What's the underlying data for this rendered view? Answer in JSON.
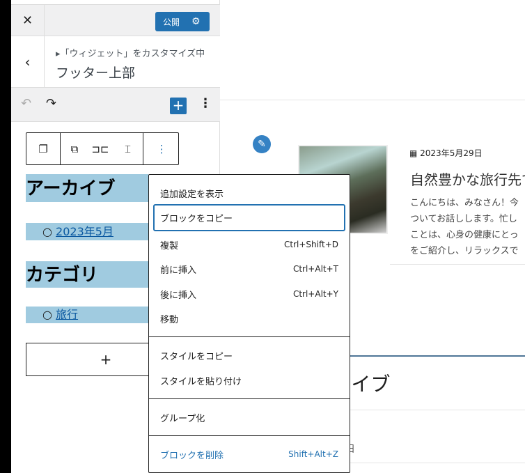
{
  "header": {
    "close_icon": "close-icon",
    "publish_label": "公開",
    "settings_icon": "gear-icon"
  },
  "nav": {
    "breadcrumb": "▸「ウィジェット」をカスタマイズ中",
    "title": "フッター上部"
  },
  "editor_toolbar": {
    "undo_icon": "undo-icon",
    "redo_icon": "redo-icon",
    "add_icon": "plus-icon",
    "options_icon": "more-vertical-icon"
  },
  "block_toolbar": {
    "icons": [
      "parent-select-icon",
      "duplicate-icon",
      "move-horizontal-icon",
      "move-vertical-icon",
      "more-vertical-icon"
    ]
  },
  "widgets": {
    "archive_heading": "アーカイブ",
    "archive_link": "2023年5月",
    "category_heading": "カテゴリ",
    "category_link": "旅行",
    "add_block": "+"
  },
  "menu": {
    "items": [
      {
        "label": "追加設定を表示",
        "shortcut": ""
      },
      {
        "label": "ブロックをコピー",
        "shortcut": ""
      },
      {
        "label": "複製",
        "shortcut": "Ctrl+Shift+D"
      },
      {
        "label": "前に挿入",
        "shortcut": "Ctrl+Alt+T"
      },
      {
        "label": "後に挿入",
        "shortcut": "Ctrl+Alt+Y"
      },
      {
        "label": "移動",
        "shortcut": ""
      },
      {
        "label": "スタイルをコピー",
        "shortcut": ""
      },
      {
        "label": "スタイルを貼り付け",
        "shortcut": ""
      },
      {
        "label": "グループ化",
        "shortcut": ""
      },
      {
        "label": "ブロックを削除",
        "shortcut": "Shift+Alt+Z"
      }
    ]
  },
  "preview": {
    "edit_icon": "pencil-icon",
    "post_date": "2023年5月29日",
    "post_title": "自然豊かな旅行先で",
    "excerpt": [
      "こんにちは、みなさん！今",
      "ついてお話しします。忙し",
      "ことは、心身の健康にとっ",
      "をご紹介し、リラックスで"
    ],
    "archive_heading": "アーカイブ",
    "partial_text": "日"
  },
  "colors": {
    "accent": "#2271b1",
    "highlight": "#a0cbe0"
  }
}
